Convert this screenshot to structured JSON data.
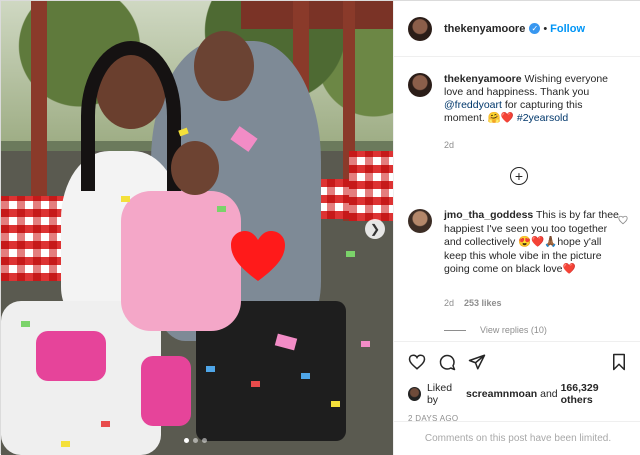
{
  "post": {
    "username": "thekenyamoore",
    "follow_label": "Follow",
    "separator": "•"
  },
  "caption": {
    "username": "thekenyamoore",
    "text_1": "Wishing everyone love and happiness. Thank you",
    "mention": "@freddyoart",
    "text_2": "for capturing this moment.",
    "emojis": "🤗❤️",
    "hashtag": "#2yearsold",
    "age": "2d"
  },
  "comment": {
    "username": "jmo_tha_goddess",
    "text": "This is by far thee happiest I've seen you too together and collectively 😍❤️🙏🏾hope y'all keep this whole vibe in the picture going come on black love❤️",
    "age": "2d",
    "likes": "253 likes",
    "view_replies": "View replies (10)"
  },
  "likes": {
    "prefix": "Liked by",
    "user": "screamnmoan",
    "suffix": "and",
    "count": "166,329 others"
  },
  "timestamp": "2 DAYS AGO",
  "comments_limited": "Comments on this post have been limited.",
  "colors": {
    "accent": "#0095f6",
    "verified": "#3897f0",
    "muted": "#8e8e8e"
  },
  "icons": {
    "verified": "verified-badge-icon",
    "load_more": "plus-circle-icon",
    "like": "heart-icon",
    "comment": "comment-bubble-icon",
    "share": "paper-plane-icon",
    "save": "bookmark-icon",
    "carousel": "chevron-right-icon"
  }
}
